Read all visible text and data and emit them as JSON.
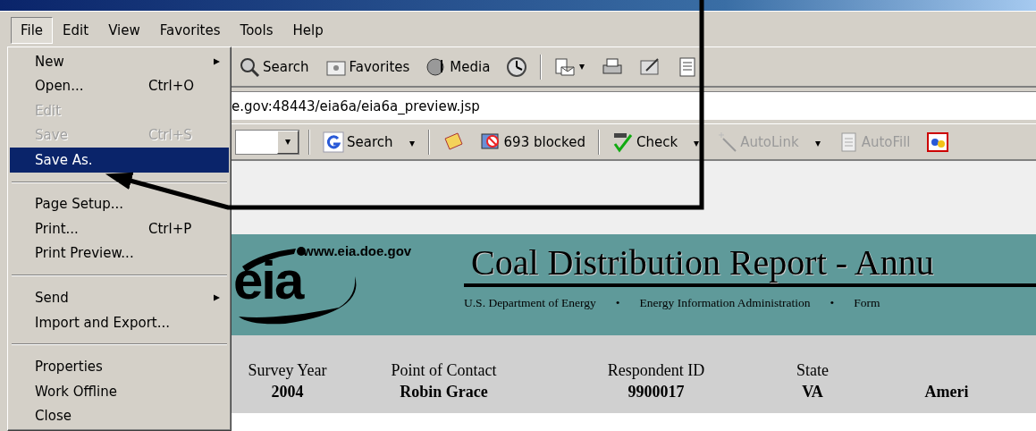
{
  "menubar": [
    {
      "label": "File",
      "selected": true
    },
    {
      "label": "Edit",
      "selected": false
    },
    {
      "label": "View",
      "selected": false
    },
    {
      "label": "Favorites",
      "selected": false
    },
    {
      "label": "Tools",
      "selected": false
    },
    {
      "label": "Help",
      "selected": false
    }
  ],
  "file_menu": [
    {
      "kind": "item",
      "label": "New",
      "submenu": true,
      "disabled": false,
      "selected": false
    },
    {
      "kind": "item",
      "label": "Open...",
      "shortcut": "Ctrl+O",
      "disabled": false,
      "selected": false
    },
    {
      "kind": "item",
      "label": "Edit",
      "disabled": true,
      "selected": false
    },
    {
      "kind": "item",
      "label": "Save",
      "shortcut": "Ctrl+S",
      "disabled": true,
      "selected": false
    },
    {
      "kind": "item",
      "label": "Save As.",
      "disabled": false,
      "selected": true
    },
    {
      "kind": "separator"
    },
    {
      "kind": "item",
      "label": "Page Setup...",
      "disabled": false,
      "selected": false
    },
    {
      "kind": "item",
      "label": "Print...",
      "shortcut": "Ctrl+P",
      "disabled": false,
      "selected": false
    },
    {
      "kind": "item",
      "label": "Print Preview...",
      "disabled": false,
      "selected": false
    },
    {
      "kind": "separator"
    },
    {
      "kind": "item",
      "label": "Send",
      "submenu": true,
      "disabled": false,
      "selected": false
    },
    {
      "kind": "item",
      "label": "Import and Export...",
      "disabled": false,
      "selected": false
    },
    {
      "kind": "separator"
    },
    {
      "kind": "item",
      "label": "Properties",
      "disabled": false,
      "selected": false
    },
    {
      "kind": "item",
      "label": "Work Offline",
      "disabled": false,
      "selected": false
    },
    {
      "kind": "item",
      "label": "Close",
      "disabled": false,
      "selected": false
    }
  ],
  "toolbar": [
    {
      "kind": "search",
      "label": "Search"
    },
    {
      "kind": "favorites",
      "label": "Favorites"
    },
    {
      "kind": "media",
      "label": "Media"
    },
    {
      "kind": "history"
    },
    {
      "kind": "separator"
    },
    {
      "kind": "mail"
    },
    {
      "kind": "print"
    },
    {
      "kind": "edit"
    },
    {
      "kind": "discuss"
    }
  ],
  "address": {
    "value": "e.gov:48443/eia6a/eia6a_preview.jsp"
  },
  "google_toolbar": [
    {
      "kind": "combo"
    },
    {
      "kind": "separator"
    },
    {
      "kind": "google-search",
      "label": "Search",
      "disabled": false
    },
    {
      "kind": "separator"
    },
    {
      "kind": "news"
    },
    {
      "kind": "popup-blocker",
      "label": "693 blocked",
      "disabled": false
    },
    {
      "kind": "separator"
    },
    {
      "kind": "spellcheck",
      "label": "Check",
      "disabled": false
    },
    {
      "kind": "autolink",
      "label": "AutoLink",
      "disabled": true
    },
    {
      "kind": "autofill",
      "label": "AutoFill",
      "disabled": true
    },
    {
      "kind": "options"
    }
  ],
  "banner": {
    "logo_url": "www.eia.doe.gov",
    "logo_text": "eia",
    "title": "Coal Distribution Report - Annu",
    "subtitle": [
      "U.S. Department of Energy",
      "•",
      "Energy Information Administration",
      "•",
      "Form"
    ]
  },
  "info_fields": [
    {
      "label": "Survey Year",
      "value": "2004"
    },
    {
      "label": "Point of Contact",
      "value": "Robin Grace"
    },
    {
      "label": "Respondent ID",
      "value": "9900017"
    },
    {
      "label": "State",
      "value": "VA"
    },
    {
      "value": "Ameri"
    }
  ]
}
